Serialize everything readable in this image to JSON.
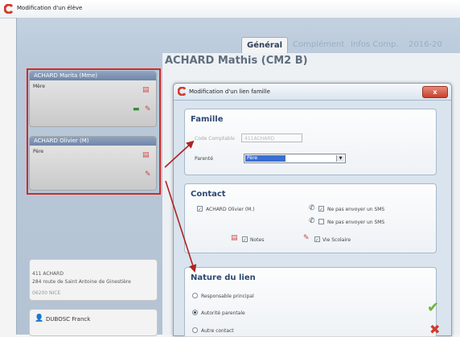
{
  "window": {
    "title": "Modification d'un élève"
  },
  "tabs": [
    {
      "label": "Général"
    },
    {
      "label": "Complément"
    },
    {
      "label": "Infos Comp."
    },
    {
      "label": "2016-20"
    }
  ],
  "student": {
    "name": "ACHARD Mathis (CM2 B)"
  },
  "parents": [
    {
      "name": "ACHARD Marita  (Mme)",
      "role": "Mère"
    },
    {
      "name": "ACHARD Olivier  (M)",
      "role": "Père"
    }
  ],
  "address": {
    "line1": "411 ACHARD",
    "line2": "284 route de Saint Antoine de Ginestière",
    "line3": "06200 NICE"
  },
  "contact_card": {
    "name": "DUBOSC Franck"
  },
  "dialog": {
    "title": "Modification d'un lien famille",
    "close_label": "x",
    "famille": {
      "title": "Famille",
      "code_label": "Code Comptable",
      "code_value": "411ACHARD",
      "parente_label": "Parenté",
      "parente_value": "Père"
    },
    "contact": {
      "title": "Contact",
      "person_label": "ACHARD Olivier (M.)",
      "sms1_label": "Ne pas envoyer un SMS",
      "sms2_label": "Ne pas envoyer un SMS",
      "notes_label": "Notes",
      "vie_scolaire_label": "Vie Scolaire"
    },
    "nature": {
      "title": "Nature du lien",
      "options": [
        {
          "label": "Responsable principal",
          "selected": false
        },
        {
          "label": "Autorité parentale",
          "selected": true
        },
        {
          "label": "Autre contact",
          "selected": false
        }
      ]
    }
  },
  "colors": {
    "accent_red": "#d02a2a",
    "header_blue": "#6f86a8",
    "title_blue": "#2c4870"
  }
}
